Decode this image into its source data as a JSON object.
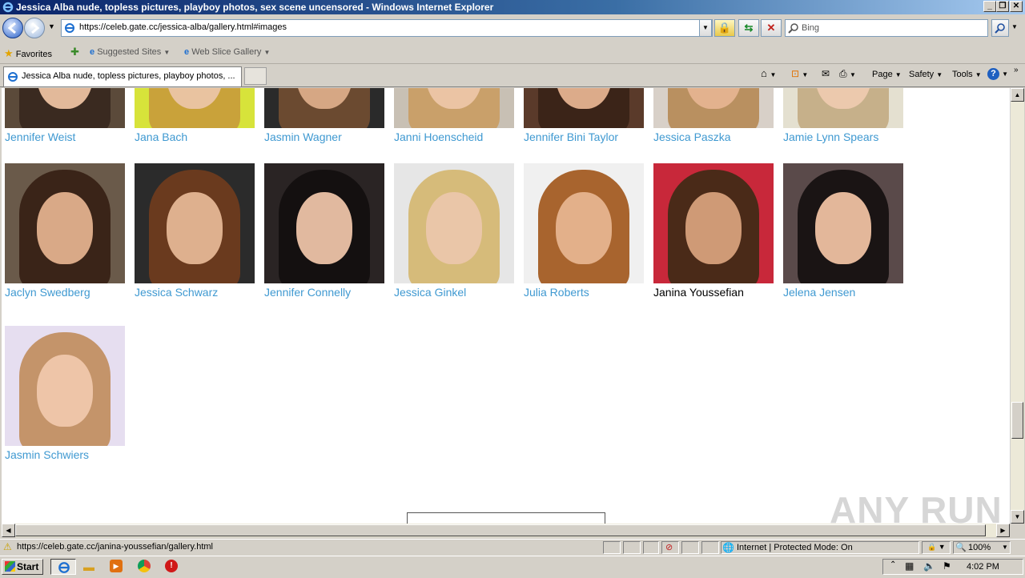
{
  "window": {
    "title": "Jessica Alba nude, topless pictures, playboy photos, sex scene uncensored - Windows Internet Explorer",
    "buttons": [
      "_",
      "❐",
      "✕"
    ]
  },
  "address_bar": {
    "url": "https://celeb.gate.cc/jessica-alba/gallery.html#images",
    "search_placeholder": "Bing"
  },
  "favorites_bar": {
    "favorites": "Favorites",
    "suggested": "Suggested Sites",
    "webslice": "Web Slice Gallery"
  },
  "tabs": [
    {
      "label": "Jessica Alba nude, topless pictures, playboy photos, ..."
    }
  ],
  "command_bar": {
    "page": "Page",
    "safety": "Safety",
    "tools": "Tools"
  },
  "gallery": {
    "row1": [
      {
        "name": "Jennifer Weist",
        "hair": "#3a2a20",
        "skin": "#e2b99a",
        "bg": "#5b4a3a"
      },
      {
        "name": "Jana Bach",
        "hair": "#c9a23a",
        "skin": "#e9c3a0",
        "bg": "#d7e33a"
      },
      {
        "name": "Jasmin Wagner",
        "hair": "#6b4a30",
        "skin": "#d6a784",
        "bg": "#2a2a2a"
      },
      {
        "name": "Janni Hoenscheid",
        "hair": "#c9a06a",
        "skin": "#ebc4a4",
        "bg": "#c8c0b4"
      },
      {
        "name": "Jennifer Bini Taylor",
        "hair": "#3b2418",
        "skin": "#dcab8a",
        "bg": "#5a3a2a"
      },
      {
        "name": "Jessica Paszka",
        "hair": "#b99060",
        "skin": "#e3b28e",
        "bg": "#d8d0c8"
      },
      {
        "name": "Jamie Lynn Spears",
        "hair": "#c6b08a",
        "skin": "#ecc9ad",
        "bg": "#e4e0d0"
      }
    ],
    "row2": [
      {
        "name": "Jaclyn Swedberg",
        "hair": "#3a2418",
        "skin": "#d9a987",
        "bg": "#6a5a4a"
      },
      {
        "name": "Jessica Schwarz",
        "hair": "#6a3a1e",
        "skin": "#deb08e",
        "bg": "#2b2b2b"
      },
      {
        "name": "Jennifer Connelly",
        "hair": "#141010",
        "skin": "#e1b99f",
        "bg": "#2a2424"
      },
      {
        "name": "Jessica Ginkel",
        "hair": "#d6bb7a",
        "skin": "#eac6a8",
        "bg": "#e6e6e6"
      },
      {
        "name": "Julia Roberts",
        "hair": "#a8642e",
        "skin": "#e3b08a",
        "bg": "#f0f0f0"
      },
      {
        "name": "Janina Youssefian",
        "hair": "#4a2a18",
        "skin": "#cf9a76",
        "bg": "#c8283a"
      },
      {
        "name": "Jelena Jensen",
        "hair": "#1a1414",
        "skin": "#e3b79a",
        "bg": "#5a4a4a"
      }
    ],
    "row3": [
      {
        "name": "Jasmin Schwiers",
        "hair": "#c4946a",
        "skin": "#eec5a8",
        "bg": "#e6def0"
      }
    ]
  },
  "status_bar": {
    "url": "https://celeb.gate.cc/janina-youssefian/gallery.html",
    "zone": "Internet | Protected Mode: On",
    "zoom": "100%"
  },
  "taskbar": {
    "start": "Start",
    "time": "4:02 PM"
  },
  "watermark": "ANY RUN"
}
